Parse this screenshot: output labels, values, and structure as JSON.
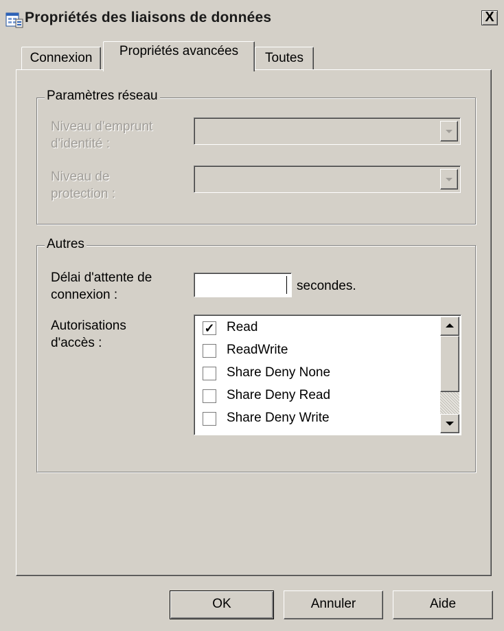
{
  "window": {
    "title": "Propriétés des liaisons de données",
    "close_label": "X",
    "icon": "data-link-icon"
  },
  "tabs": [
    {
      "label": "Connexion",
      "active": false
    },
    {
      "label": "Propriétés avancées",
      "active": true
    },
    {
      "label": "Toutes",
      "active": false
    }
  ],
  "network": {
    "group_label": "Paramètres réseau",
    "impersonation_label_1": "Niveau d'emprunt",
    "impersonation_label_2": "d'identité :",
    "impersonation_value": "",
    "protection_label_1": "Niveau de",
    "protection_label_2": "protection :",
    "protection_value": "",
    "disabled": true
  },
  "others": {
    "group_label": "Autres",
    "timeout_label_1": "Délai d'attente de",
    "timeout_label_2": "connexion :",
    "timeout_value": "",
    "timeout_unit": "secondes.",
    "access_label_1": "Autorisations",
    "access_label_2": "d'accès :",
    "permissions": [
      {
        "label": "Read",
        "checked": true,
        "mark": "✓"
      },
      {
        "label": "ReadWrite",
        "checked": false,
        "mark": ""
      },
      {
        "label": "Share Deny None",
        "checked": false,
        "mark": ""
      },
      {
        "label": "Share Deny Read",
        "checked": false,
        "mark": ""
      },
      {
        "label": "Share Deny Write",
        "checked": false,
        "mark": ""
      }
    ]
  },
  "buttons": {
    "ok": "OK",
    "cancel": "Annuler",
    "help": "Aide"
  }
}
